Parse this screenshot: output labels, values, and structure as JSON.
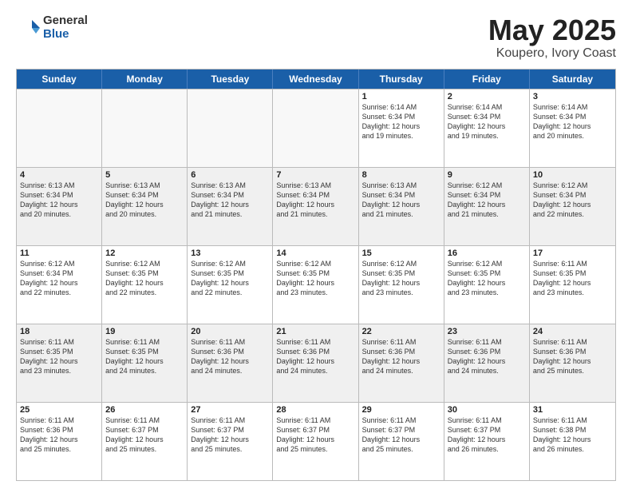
{
  "header": {
    "logo_general": "General",
    "logo_blue": "Blue",
    "title": "May 2025",
    "subtitle": "Koupero, Ivory Coast"
  },
  "days": [
    "Sunday",
    "Monday",
    "Tuesday",
    "Wednesday",
    "Thursday",
    "Friday",
    "Saturday"
  ],
  "rows": [
    [
      {
        "date": "",
        "info": "",
        "empty": true
      },
      {
        "date": "",
        "info": "",
        "empty": true
      },
      {
        "date": "",
        "info": "",
        "empty": true
      },
      {
        "date": "",
        "info": "",
        "empty": true
      },
      {
        "date": "1",
        "info": "Sunrise: 6:14 AM\nSunset: 6:34 PM\nDaylight: 12 hours\nand 19 minutes.",
        "empty": false
      },
      {
        "date": "2",
        "info": "Sunrise: 6:14 AM\nSunset: 6:34 PM\nDaylight: 12 hours\nand 19 minutes.",
        "empty": false
      },
      {
        "date": "3",
        "info": "Sunrise: 6:14 AM\nSunset: 6:34 PM\nDaylight: 12 hours\nand 20 minutes.",
        "empty": false
      }
    ],
    [
      {
        "date": "4",
        "info": "Sunrise: 6:13 AM\nSunset: 6:34 PM\nDaylight: 12 hours\nand 20 minutes.",
        "empty": false
      },
      {
        "date": "5",
        "info": "Sunrise: 6:13 AM\nSunset: 6:34 PM\nDaylight: 12 hours\nand 20 minutes.",
        "empty": false
      },
      {
        "date": "6",
        "info": "Sunrise: 6:13 AM\nSunset: 6:34 PM\nDaylight: 12 hours\nand 21 minutes.",
        "empty": false
      },
      {
        "date": "7",
        "info": "Sunrise: 6:13 AM\nSunset: 6:34 PM\nDaylight: 12 hours\nand 21 minutes.",
        "empty": false
      },
      {
        "date": "8",
        "info": "Sunrise: 6:13 AM\nSunset: 6:34 PM\nDaylight: 12 hours\nand 21 minutes.",
        "empty": false
      },
      {
        "date": "9",
        "info": "Sunrise: 6:12 AM\nSunset: 6:34 PM\nDaylight: 12 hours\nand 21 minutes.",
        "empty": false
      },
      {
        "date": "10",
        "info": "Sunrise: 6:12 AM\nSunset: 6:34 PM\nDaylight: 12 hours\nand 22 minutes.",
        "empty": false
      }
    ],
    [
      {
        "date": "11",
        "info": "Sunrise: 6:12 AM\nSunset: 6:34 PM\nDaylight: 12 hours\nand 22 minutes.",
        "empty": false
      },
      {
        "date": "12",
        "info": "Sunrise: 6:12 AM\nSunset: 6:35 PM\nDaylight: 12 hours\nand 22 minutes.",
        "empty": false
      },
      {
        "date": "13",
        "info": "Sunrise: 6:12 AM\nSunset: 6:35 PM\nDaylight: 12 hours\nand 22 minutes.",
        "empty": false
      },
      {
        "date": "14",
        "info": "Sunrise: 6:12 AM\nSunset: 6:35 PM\nDaylight: 12 hours\nand 23 minutes.",
        "empty": false
      },
      {
        "date": "15",
        "info": "Sunrise: 6:12 AM\nSunset: 6:35 PM\nDaylight: 12 hours\nand 23 minutes.",
        "empty": false
      },
      {
        "date": "16",
        "info": "Sunrise: 6:12 AM\nSunset: 6:35 PM\nDaylight: 12 hours\nand 23 minutes.",
        "empty": false
      },
      {
        "date": "17",
        "info": "Sunrise: 6:11 AM\nSunset: 6:35 PM\nDaylight: 12 hours\nand 23 minutes.",
        "empty": false
      }
    ],
    [
      {
        "date": "18",
        "info": "Sunrise: 6:11 AM\nSunset: 6:35 PM\nDaylight: 12 hours\nand 23 minutes.",
        "empty": false
      },
      {
        "date": "19",
        "info": "Sunrise: 6:11 AM\nSunset: 6:35 PM\nDaylight: 12 hours\nand 24 minutes.",
        "empty": false
      },
      {
        "date": "20",
        "info": "Sunrise: 6:11 AM\nSunset: 6:36 PM\nDaylight: 12 hours\nand 24 minutes.",
        "empty": false
      },
      {
        "date": "21",
        "info": "Sunrise: 6:11 AM\nSunset: 6:36 PM\nDaylight: 12 hours\nand 24 minutes.",
        "empty": false
      },
      {
        "date": "22",
        "info": "Sunrise: 6:11 AM\nSunset: 6:36 PM\nDaylight: 12 hours\nand 24 minutes.",
        "empty": false
      },
      {
        "date": "23",
        "info": "Sunrise: 6:11 AM\nSunset: 6:36 PM\nDaylight: 12 hours\nand 24 minutes.",
        "empty": false
      },
      {
        "date": "24",
        "info": "Sunrise: 6:11 AM\nSunset: 6:36 PM\nDaylight: 12 hours\nand 25 minutes.",
        "empty": false
      }
    ],
    [
      {
        "date": "25",
        "info": "Sunrise: 6:11 AM\nSunset: 6:36 PM\nDaylight: 12 hours\nand 25 minutes.",
        "empty": false
      },
      {
        "date": "26",
        "info": "Sunrise: 6:11 AM\nSunset: 6:37 PM\nDaylight: 12 hours\nand 25 minutes.",
        "empty": false
      },
      {
        "date": "27",
        "info": "Sunrise: 6:11 AM\nSunset: 6:37 PM\nDaylight: 12 hours\nand 25 minutes.",
        "empty": false
      },
      {
        "date": "28",
        "info": "Sunrise: 6:11 AM\nSunset: 6:37 PM\nDaylight: 12 hours\nand 25 minutes.",
        "empty": false
      },
      {
        "date": "29",
        "info": "Sunrise: 6:11 AM\nSunset: 6:37 PM\nDaylight: 12 hours\nand 25 minutes.",
        "empty": false
      },
      {
        "date": "30",
        "info": "Sunrise: 6:11 AM\nSunset: 6:37 PM\nDaylight: 12 hours\nand 26 minutes.",
        "empty": false
      },
      {
        "date": "31",
        "info": "Sunrise: 6:11 AM\nSunset: 6:38 PM\nDaylight: 12 hours\nand 26 minutes.",
        "empty": false
      }
    ]
  ]
}
